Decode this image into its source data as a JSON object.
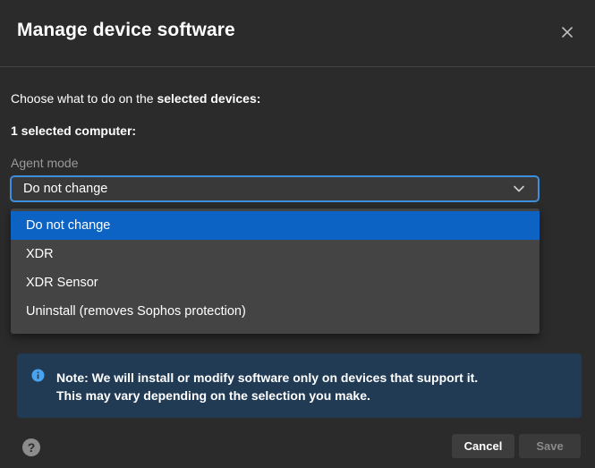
{
  "dialog": {
    "title": "Manage device software"
  },
  "intro": {
    "prefix": "Choose what to do on the ",
    "emphasis": "selected devices:"
  },
  "selected_count": "1 selected computer:",
  "agent_mode": {
    "label": "Agent mode",
    "value": "Do not change",
    "options": [
      "Do not change",
      "XDR",
      "XDR Sensor",
      "Uninstall (removes Sophos protection)"
    ],
    "highlighted_index": 0
  },
  "note": {
    "line1": "Note: We will install or modify software only on devices that support it.",
    "line2": "This may vary depending on the selection you make."
  },
  "footer": {
    "cancel_label": "Cancel",
    "save_label": "Save",
    "help_glyph": "?"
  },
  "icons": {
    "close": "close-icon",
    "chevron": "chevron-down-icon",
    "info": "info-icon",
    "help": "help-icon"
  },
  "colors": {
    "background": "#2b2b2b",
    "accent_border": "#3c8fdc",
    "selected_option": "#0c63c4",
    "note_background": "#213b55",
    "info_icon": "#4aa3ee"
  }
}
